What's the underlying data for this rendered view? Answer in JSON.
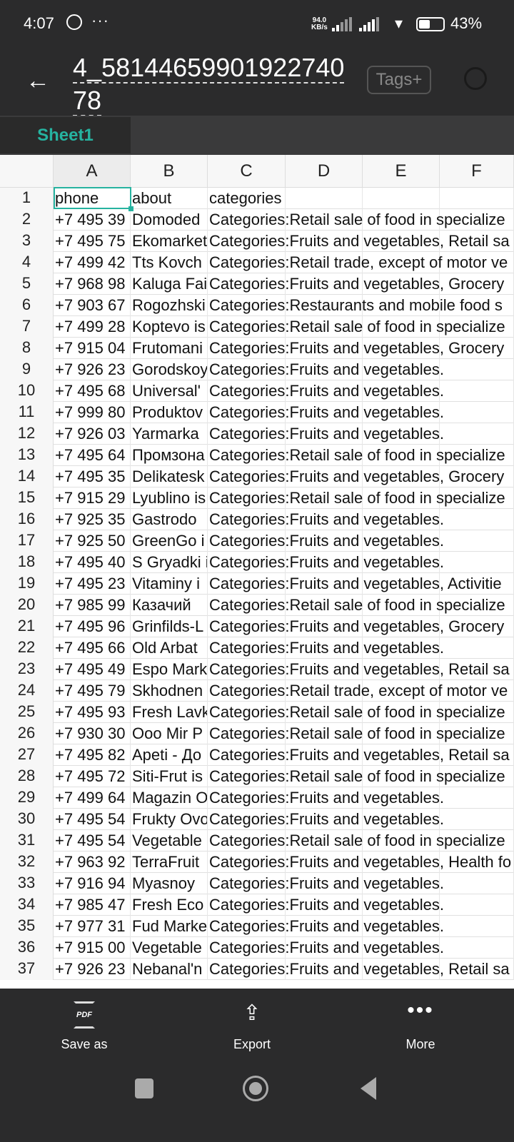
{
  "status_bar": {
    "time": "4:07",
    "net_speed": "94.0",
    "net_unit": "KB/s",
    "battery": "43%",
    "battery_level": 0.43
  },
  "header": {
    "title": "4_5814465990192274078",
    "tags_label": "Tags",
    "tags_plus": "+"
  },
  "sheets": [
    {
      "label": "Sheet1",
      "active": true
    }
  ],
  "columns": [
    "A",
    "B",
    "C",
    "D",
    "E",
    "F"
  ],
  "rows": [
    [
      "1",
      "phone",
      "about",
      "categories"
    ],
    [
      "2",
      "+7 495 39",
      "Domoded",
      "Categories:Retail sale of food in specialize"
    ],
    [
      "3",
      "+7 495 75",
      "Ekomarket",
      "Categories:Fruits and vegetables, Retail sa"
    ],
    [
      "4",
      "+7 499 42",
      "Tts Kovch",
      "Categories:Retail trade, except of motor ve"
    ],
    [
      "5",
      "+7 968 98",
      "Kaluga Fai",
      "Categories:Fruits and vegetables, Grocery"
    ],
    [
      "6",
      "+7 903 67",
      "Rogozhski",
      "Categories:Restaurants and mobile food s"
    ],
    [
      "7",
      "+7 499 28",
      "Koptevo is",
      "Categories:Retail sale of food in specialize"
    ],
    [
      "8",
      "+7 915 04",
      "Frutomani",
      "Categories:Fruits and vegetables, Grocery"
    ],
    [
      "9",
      "+7 926 23",
      "Gorodskoy",
      "Categories:Fruits and vegetables."
    ],
    [
      "10",
      "+7 495 68",
      "Universal'",
      "Categories:Fruits and vegetables."
    ],
    [
      "11",
      "+7 999 80",
      "Produktov",
      "Categories:Fruits and vegetables."
    ],
    [
      "12",
      "+7 926 03",
      "Yarmarka",
      "Categories:Fruits and vegetables."
    ],
    [
      "13",
      "+7 495 64",
      "Промзона",
      "Categories:Retail sale of food in specialize"
    ],
    [
      "14",
      "+7 495 35",
      "Delikatesk",
      "Categories:Fruits and vegetables, Grocery"
    ],
    [
      "15",
      "+7 915 29",
      "Lyublino is",
      "Categories:Retail sale of food in specialize"
    ],
    [
      "16",
      "+7 925 35",
      "Gastrodo",
      "Categories:Fruits and vegetables."
    ],
    [
      "17",
      "+7 925 50",
      "GreenGo i",
      "Categories:Fruits and vegetables."
    ],
    [
      "18",
      "+7 495 40",
      "S Gryadki i",
      "Categories:Fruits and vegetables."
    ],
    [
      "19",
      "+7 495 23",
      "Vitaminy i",
      "Categories:Fruits and vegetables, Activitie"
    ],
    [
      "20",
      "+7 985 99",
      "Казачий",
      "Categories:Retail sale of food in specialize"
    ],
    [
      "21",
      "+7 495 96",
      "Grinfilds-L",
      "Categories:Fruits and vegetables, Grocery"
    ],
    [
      "22",
      "+7 495 66",
      "Old Arbat",
      "Categories:Fruits and vegetables."
    ],
    [
      "23",
      "+7 495 49",
      "Espo Mark",
      "Categories:Fruits and vegetables, Retail sa"
    ],
    [
      "24",
      "+7 495 79",
      "Skhodnen",
      "Categories:Retail trade, except of motor ve"
    ],
    [
      "25",
      "+7 495 93",
      "Fresh Lavk",
      "Categories:Retail sale of food in specialize"
    ],
    [
      "26",
      "+7 930 30",
      "Ooo Mir P",
      "Categories:Retail sale of food in specialize"
    ],
    [
      "27",
      "+7 495 82",
      "Apeti - До",
      "Categories:Fruits and vegetables, Retail sa"
    ],
    [
      "28",
      "+7 495 72",
      "Siti-Frut is",
      "Categories:Retail sale of food in specialize"
    ],
    [
      "29",
      "+7 499 64",
      "Magazin O",
      "Categories:Fruits and vegetables."
    ],
    [
      "30",
      "+7 495 54",
      "Frukty Ovo",
      "Categories:Fruits and vegetables."
    ],
    [
      "31",
      "+7 495 54",
      "Vegetable",
      "Categories:Retail sale of food in specialize"
    ],
    [
      "32",
      "+7 963 92",
      "TerraFruit",
      "Categories:Fruits and vegetables, Health fo"
    ],
    [
      "33",
      "+7 916 94",
      "Myasnoy",
      "Categories:Fruits and vegetables."
    ],
    [
      "34",
      "+7 985 47",
      "Fresh Eco",
      "Categories:Fruits and vegetables."
    ],
    [
      "35",
      "+7 977 31",
      "Fud Marke",
      "Categories:Fruits and vegetables."
    ],
    [
      "36",
      "+7 915 00",
      "Vegetable",
      "Categories:Fruits and vegetables."
    ],
    [
      "37",
      "+7 926 23",
      "Nebanal'n",
      "Categories:Fruits and vegetables, Retail sa"
    ]
  ],
  "bottom_actions": [
    {
      "label": "Save as",
      "icon": "pdf-icon",
      "icon_text": "PDF"
    },
    {
      "label": "Export",
      "icon": "share-icon"
    },
    {
      "label": "More",
      "icon": "more-icon"
    }
  ],
  "accent_color": "#26b3a0"
}
